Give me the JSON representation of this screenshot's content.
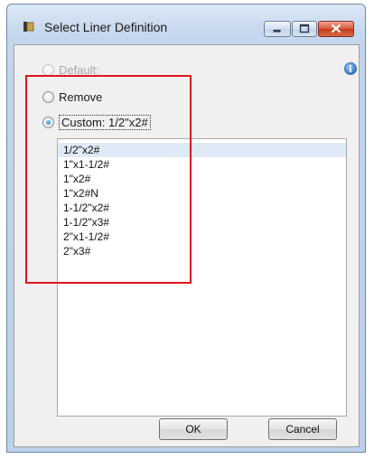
{
  "window": {
    "title": "Select Liner Definition"
  },
  "options": {
    "default_label": "Default:",
    "remove_label": "Remove",
    "custom_label": "Custom:",
    "custom_value": "1/2\"x2#"
  },
  "liners": [
    "1/2\"x2#",
    "1\"x1-1/2#",
    "1\"x2#",
    "1\"x2#N",
    "1-1/2\"x2#",
    "1-1/2\"x3#",
    "2\"x1-1/2#",
    "2\"x3#"
  ],
  "selected_index": 0,
  "buttons": {
    "ok": "OK",
    "cancel": "Cancel"
  },
  "colors": {
    "highlight_box": "#e0141b",
    "selection": "#e0eaf7",
    "accent": "#1f6fc3"
  }
}
